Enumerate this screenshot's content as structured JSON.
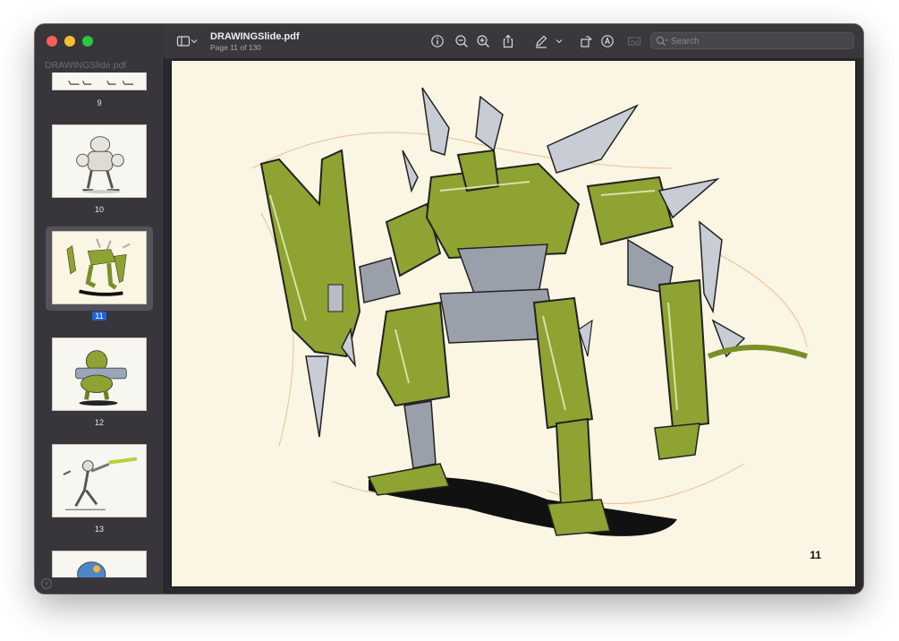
{
  "window": {
    "file_name": "DRAWINGSlide.pdf",
    "page_info": "Page 11 of 130"
  },
  "sidebar": {
    "title": "DRAWINGSlide.pdf",
    "thumbnails": [
      {
        "label": "9"
      },
      {
        "label": "10"
      },
      {
        "label": "11"
      },
      {
        "label": "12"
      },
      {
        "label": "13"
      }
    ],
    "selected": "11"
  },
  "toolbar": {
    "icons": [
      "sidebar-toggle-icon",
      "chevron-down-icon",
      "info-icon",
      "zoom-out-icon",
      "zoom-in-icon",
      "share-icon",
      "markup-pen-icon",
      "chevron-down-icon",
      "rotate-icon",
      "annotate-icon",
      "signature-icon"
    ],
    "search_placeholder": "Search"
  },
  "page": {
    "number": "11"
  },
  "colors": {
    "accent": "#1e63d6",
    "robot_green": "#8ea331",
    "paper": "#fbf5e3"
  }
}
